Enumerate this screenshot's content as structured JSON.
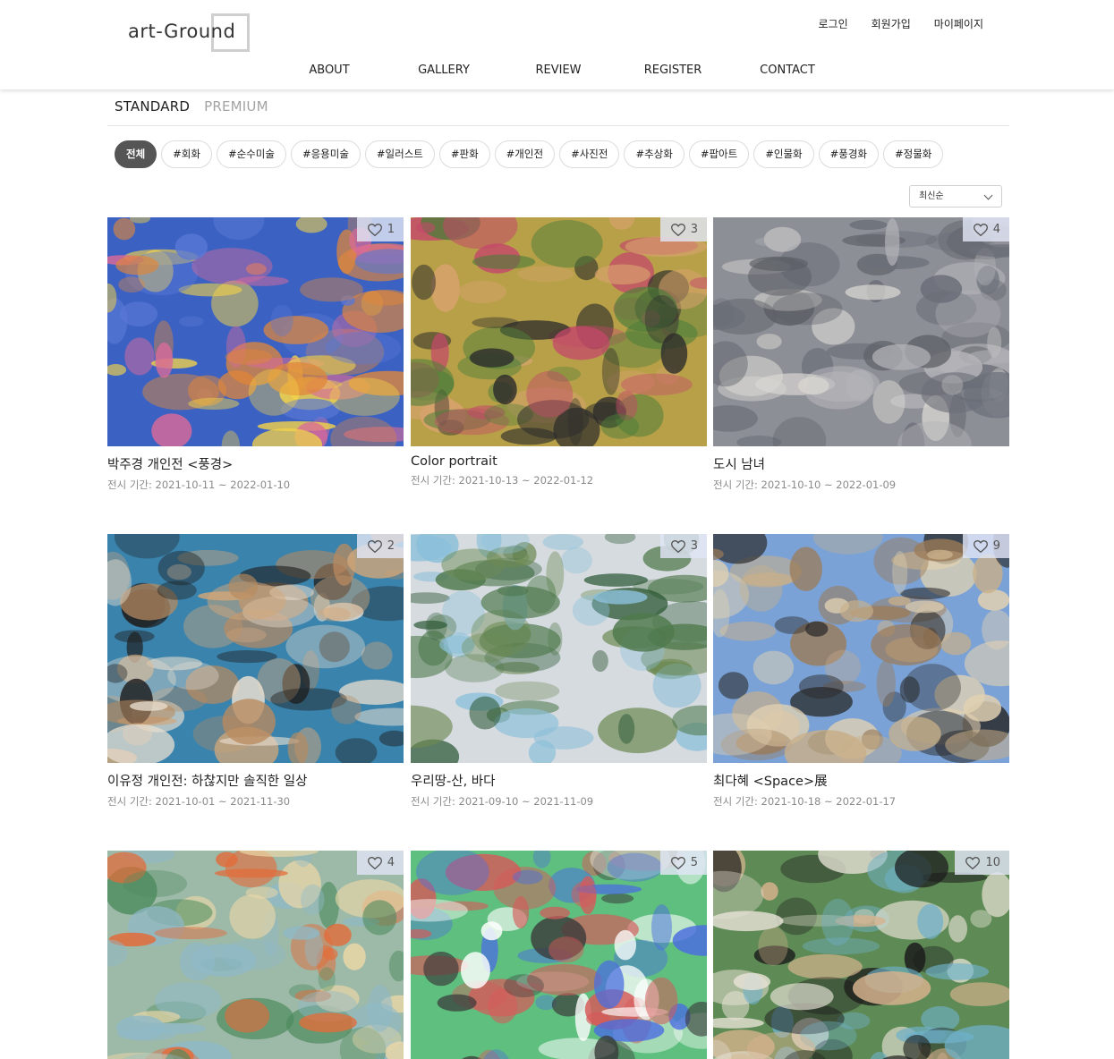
{
  "header": {
    "logo_text": "art-Ground",
    "util_nav": [
      "로그인",
      "회원가입",
      "마이페이지"
    ],
    "main_nav": [
      "ABOUT",
      "GALLERY",
      "REVIEW",
      "REGISTER",
      "CONTACT"
    ]
  },
  "tabs": [
    {
      "label": "STANDARD",
      "active": true
    },
    {
      "label": "PREMIUM",
      "active": false
    }
  ],
  "tags": [
    "전체",
    "#회화",
    "#순수미술",
    "#응용미술",
    "#일러스트",
    "#판화",
    "#개인전",
    "#사진전",
    "#추상화",
    "#팝아트",
    "#인물화",
    "#풍경화",
    "#정물화"
  ],
  "sort": {
    "selected": "최신순"
  },
  "period_prefix": "전시 기간: ",
  "cards": [
    {
      "title": "박주경 개인전 <풍경>",
      "period": "전시 기간: 2021-10-11 ~ 2022-01-10",
      "likes": "1",
      "palette": [
        "#3b62c2",
        "#e0863a",
        "#d96a9a",
        "#f2d24a",
        "#5a78d6"
      ]
    },
    {
      "title": "Color portrait",
      "period": "전시 기간: 2021-10-13 ~ 2022-01-12",
      "likes": "3",
      "palette": [
        "#b7a048",
        "#d9a36f",
        "#4d7d3a",
        "#c4486a",
        "#2b2b2b"
      ]
    },
    {
      "title": "도시 남녀",
      "period": "전시 기간: 2021-10-10 ~ 2022-01-09",
      "likes": "4",
      "palette": [
        "#8d8f97",
        "#b4b4b9",
        "#5c5f66",
        "#d9d7d2",
        "#6b6f78"
      ]
    },
    {
      "title": "이유정 개인전: 하찮지만 솔직한 일상",
      "period": "전시 기간: 2021-10-01 ~ 2021-11-30",
      "likes": "2",
      "palette": [
        "#3a83ad",
        "#d2a679",
        "#e9dfd0",
        "#1f1f1f",
        "#b98a5f"
      ]
    },
    {
      "title": "우리땅-산, 바다",
      "period": "전시 기간: 2021-09-10 ~ 2021-11-09",
      "likes": "3",
      "palette": [
        "#d6dbe0",
        "#4f7a4d",
        "#2f5a37",
        "#8bbfd9",
        "#6d8a53"
      ]
    },
    {
      "title": "최다혜 <Space>展",
      "period": "전시 기간: 2021-10-18 ~ 2022-01-17",
      "likes": "9",
      "palette": [
        "#7aa2d6",
        "#c9b08a",
        "#9c7b57",
        "#2a2a2a",
        "#e2d1b2"
      ]
    },
    {
      "title": "",
      "period": "",
      "likes": "4",
      "palette": [
        "#9db9a8",
        "#e9d7a7",
        "#e36b39",
        "#4e8c5e",
        "#8fb9c8"
      ]
    },
    {
      "title": "",
      "period": "",
      "likes": "5",
      "palette": [
        "#5fbf7f",
        "#4a6de0",
        "#ffffff",
        "#d65a5a",
        "#3a3a3a"
      ]
    },
    {
      "title": "",
      "period": "",
      "likes": "10",
      "palette": [
        "#5e8a55",
        "#d7b38e",
        "#1c1c1c",
        "#6fb1c9",
        "#e7e2d6"
      ]
    }
  ]
}
